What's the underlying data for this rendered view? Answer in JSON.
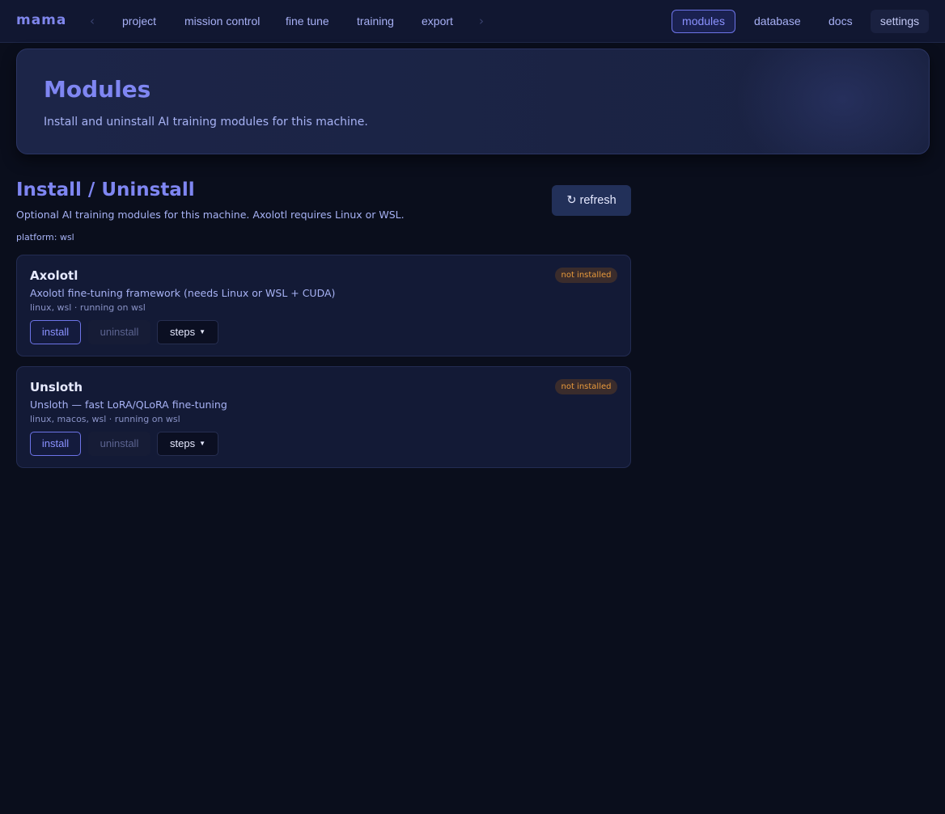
{
  "app": {
    "brand": "mama"
  },
  "nav": {
    "prev_glyph": "‹",
    "next_glyph": "›",
    "items": [
      {
        "label": "project"
      },
      {
        "label": "mission control"
      },
      {
        "label": "fine tune"
      },
      {
        "label": "training"
      },
      {
        "label": "export"
      }
    ],
    "right": [
      {
        "label": "modules",
        "active": true
      },
      {
        "label": "database"
      },
      {
        "label": "docs"
      },
      {
        "label": "settings"
      }
    ]
  },
  "hero": {
    "title": "Modules",
    "subtitle": "Install and uninstall AI training modules for this machine."
  },
  "section": {
    "title": "Install / Uninstall",
    "subtitle": "Optional AI training modules for this machine. Axolotl requires Linux or WSL.",
    "platform": "platform: wsl",
    "refresh_label": "↻ refresh"
  },
  "modules": [
    {
      "name": "Axolotl",
      "description": "Axolotl fine-tuning framework (needs Linux or WSL + CUDA)",
      "meta": "linux, wsl · running on wsl",
      "status": "not installed",
      "install_label": "install",
      "uninstall_label": "uninstall",
      "steps_label": "steps"
    },
    {
      "name": "Unsloth",
      "description": "Unsloth — fast LoRA/QLoRA fine-tuning",
      "meta": "linux, macos, wsl · running on wsl",
      "status": "not installed",
      "install_label": "install",
      "uninstall_label": "uninstall",
      "steps_label": "steps"
    }
  ],
  "colors": {
    "background": "#0a0e1c",
    "topbar": "#111731",
    "accent": "#7f86f2",
    "status_warning": "#e99a3c"
  }
}
